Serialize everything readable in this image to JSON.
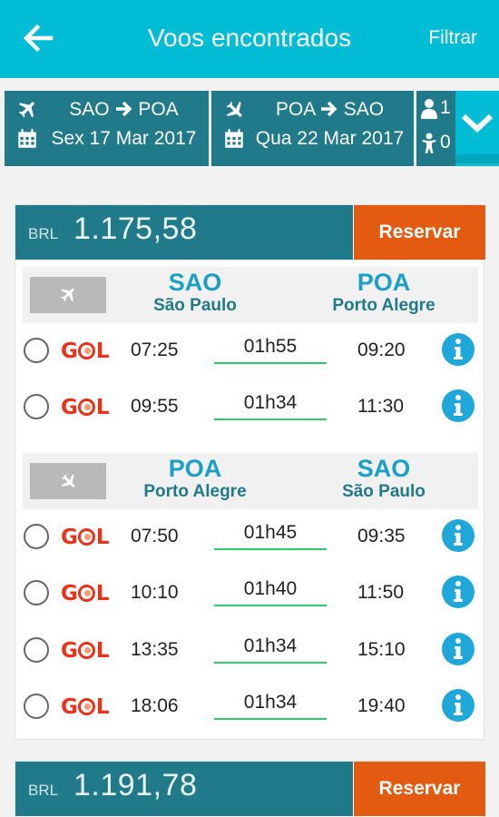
{
  "appbar": {
    "title": "Voos encontrados",
    "filter_label": "Filtrar"
  },
  "search": {
    "outbound": {
      "route_from": "SAO",
      "route_to": "POA",
      "date": "Sex 17 Mar 2017"
    },
    "inbound": {
      "route_from": "POA",
      "route_to": "SAO",
      "date": "Qua 22 Mar 2017"
    },
    "adults": "1",
    "children": "0"
  },
  "results": [
    {
      "currency": "BRL",
      "price": "1.175,58",
      "reserve_label": "Reservar",
      "outbound": {
        "from_code": "SAO",
        "from_name": "São Paulo",
        "to_code": "POA",
        "to_name": "Porto Alegre",
        "flights": [
          {
            "airline": "GOL",
            "departure": "07:25",
            "duration": "01h55",
            "arrival": "09:20"
          },
          {
            "airline": "GOL",
            "departure": "09:55",
            "duration": "01h34",
            "arrival": "11:30"
          }
        ]
      },
      "inbound": {
        "from_code": "POA",
        "from_name": "Porto Alegre",
        "to_code": "SAO",
        "to_name": "São Paulo",
        "flights": [
          {
            "airline": "GOL",
            "departure": "07:50",
            "duration": "01h45",
            "arrival": "09:35"
          },
          {
            "airline": "GOL",
            "departure": "10:10",
            "duration": "01h40",
            "arrival": "11:50"
          },
          {
            "airline": "GOL",
            "departure": "13:35",
            "duration": "01h34",
            "arrival": "15:10"
          },
          {
            "airline": "GOL",
            "departure": "18:06",
            "duration": "01h34",
            "arrival": "19:40"
          }
        ]
      }
    },
    {
      "currency": "BRL",
      "price": "1.191,78",
      "reserve_label": "Reservar"
    }
  ],
  "colors": {
    "primary": "#00bcd4",
    "dark_teal": "#217a8a",
    "reserve": "#e35b11",
    "duration_line": "#2ecc71",
    "info": "#1ea7d8"
  },
  "icons": {
    "back": "arrow-left-icon",
    "plane": "plane-icon",
    "calendar": "calendar-icon",
    "adult": "person-icon",
    "child": "child-icon",
    "confirm": "chevron-down-icon",
    "info": "info-icon"
  }
}
